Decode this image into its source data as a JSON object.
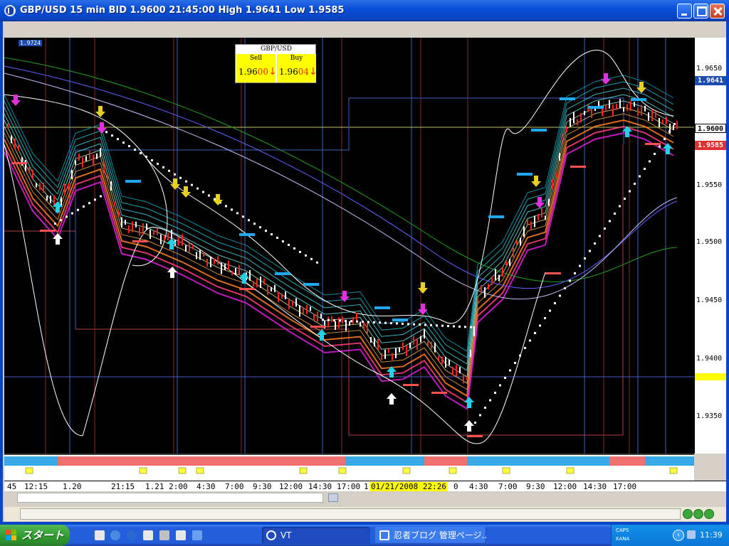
{
  "window": {
    "title": "GBP/USD 15 min BID 1.9600 21:45:00 High 1.9641 Low 1.9585"
  },
  "quote_box": {
    "title": "GBP/USD",
    "sell_label": "Sell",
    "buy_label": "Buy",
    "sell_price_prefix": "1.96",
    "sell_price_pips": "00",
    "buy_price_prefix": "1.96",
    "buy_price_pips": "04",
    "arrow": "↓"
  },
  "chart": {
    "high_marker": "1.9724",
    "price_ticks": [
      "1.9650",
      "1.9550",
      "1.9500",
      "1.9450",
      "1.9400",
      "1.9350"
    ],
    "price_tags": {
      "high": "1.9641",
      "current": "1.9600",
      "low": "1.9585"
    },
    "colors": {
      "background": "#000000",
      "high_tag": "#1c4cb0",
      "low_tag": "#e03030",
      "buy_arrow": "#22d0e8",
      "sell_arrow": "#e8d020",
      "grid_blue": "#4060c0",
      "grid_red": "#b04040"
    }
  },
  "time_axis": {
    "labels": [
      "45",
      "12:15",
      "1.20",
      "21:15",
      "1.21 2:00",
      "4:30",
      "7:00",
      "9:30",
      "12:00",
      "14:30",
      "17:00",
      "1",
      "0",
      "4:30",
      "7:00",
      "9:30",
      "12:00",
      "14:30",
      "17:00"
    ],
    "cursor_date": "01/21/2008 22:26"
  },
  "taskbar": {
    "start_label": "スタート",
    "tasks": [
      {
        "label": "VT"
      },
      {
        "label": "忍者ブログ 管理ページ..."
      }
    ],
    "tray_caps": "CAPS",
    "tray_kana": "KANA",
    "clock": "11:39"
  }
}
